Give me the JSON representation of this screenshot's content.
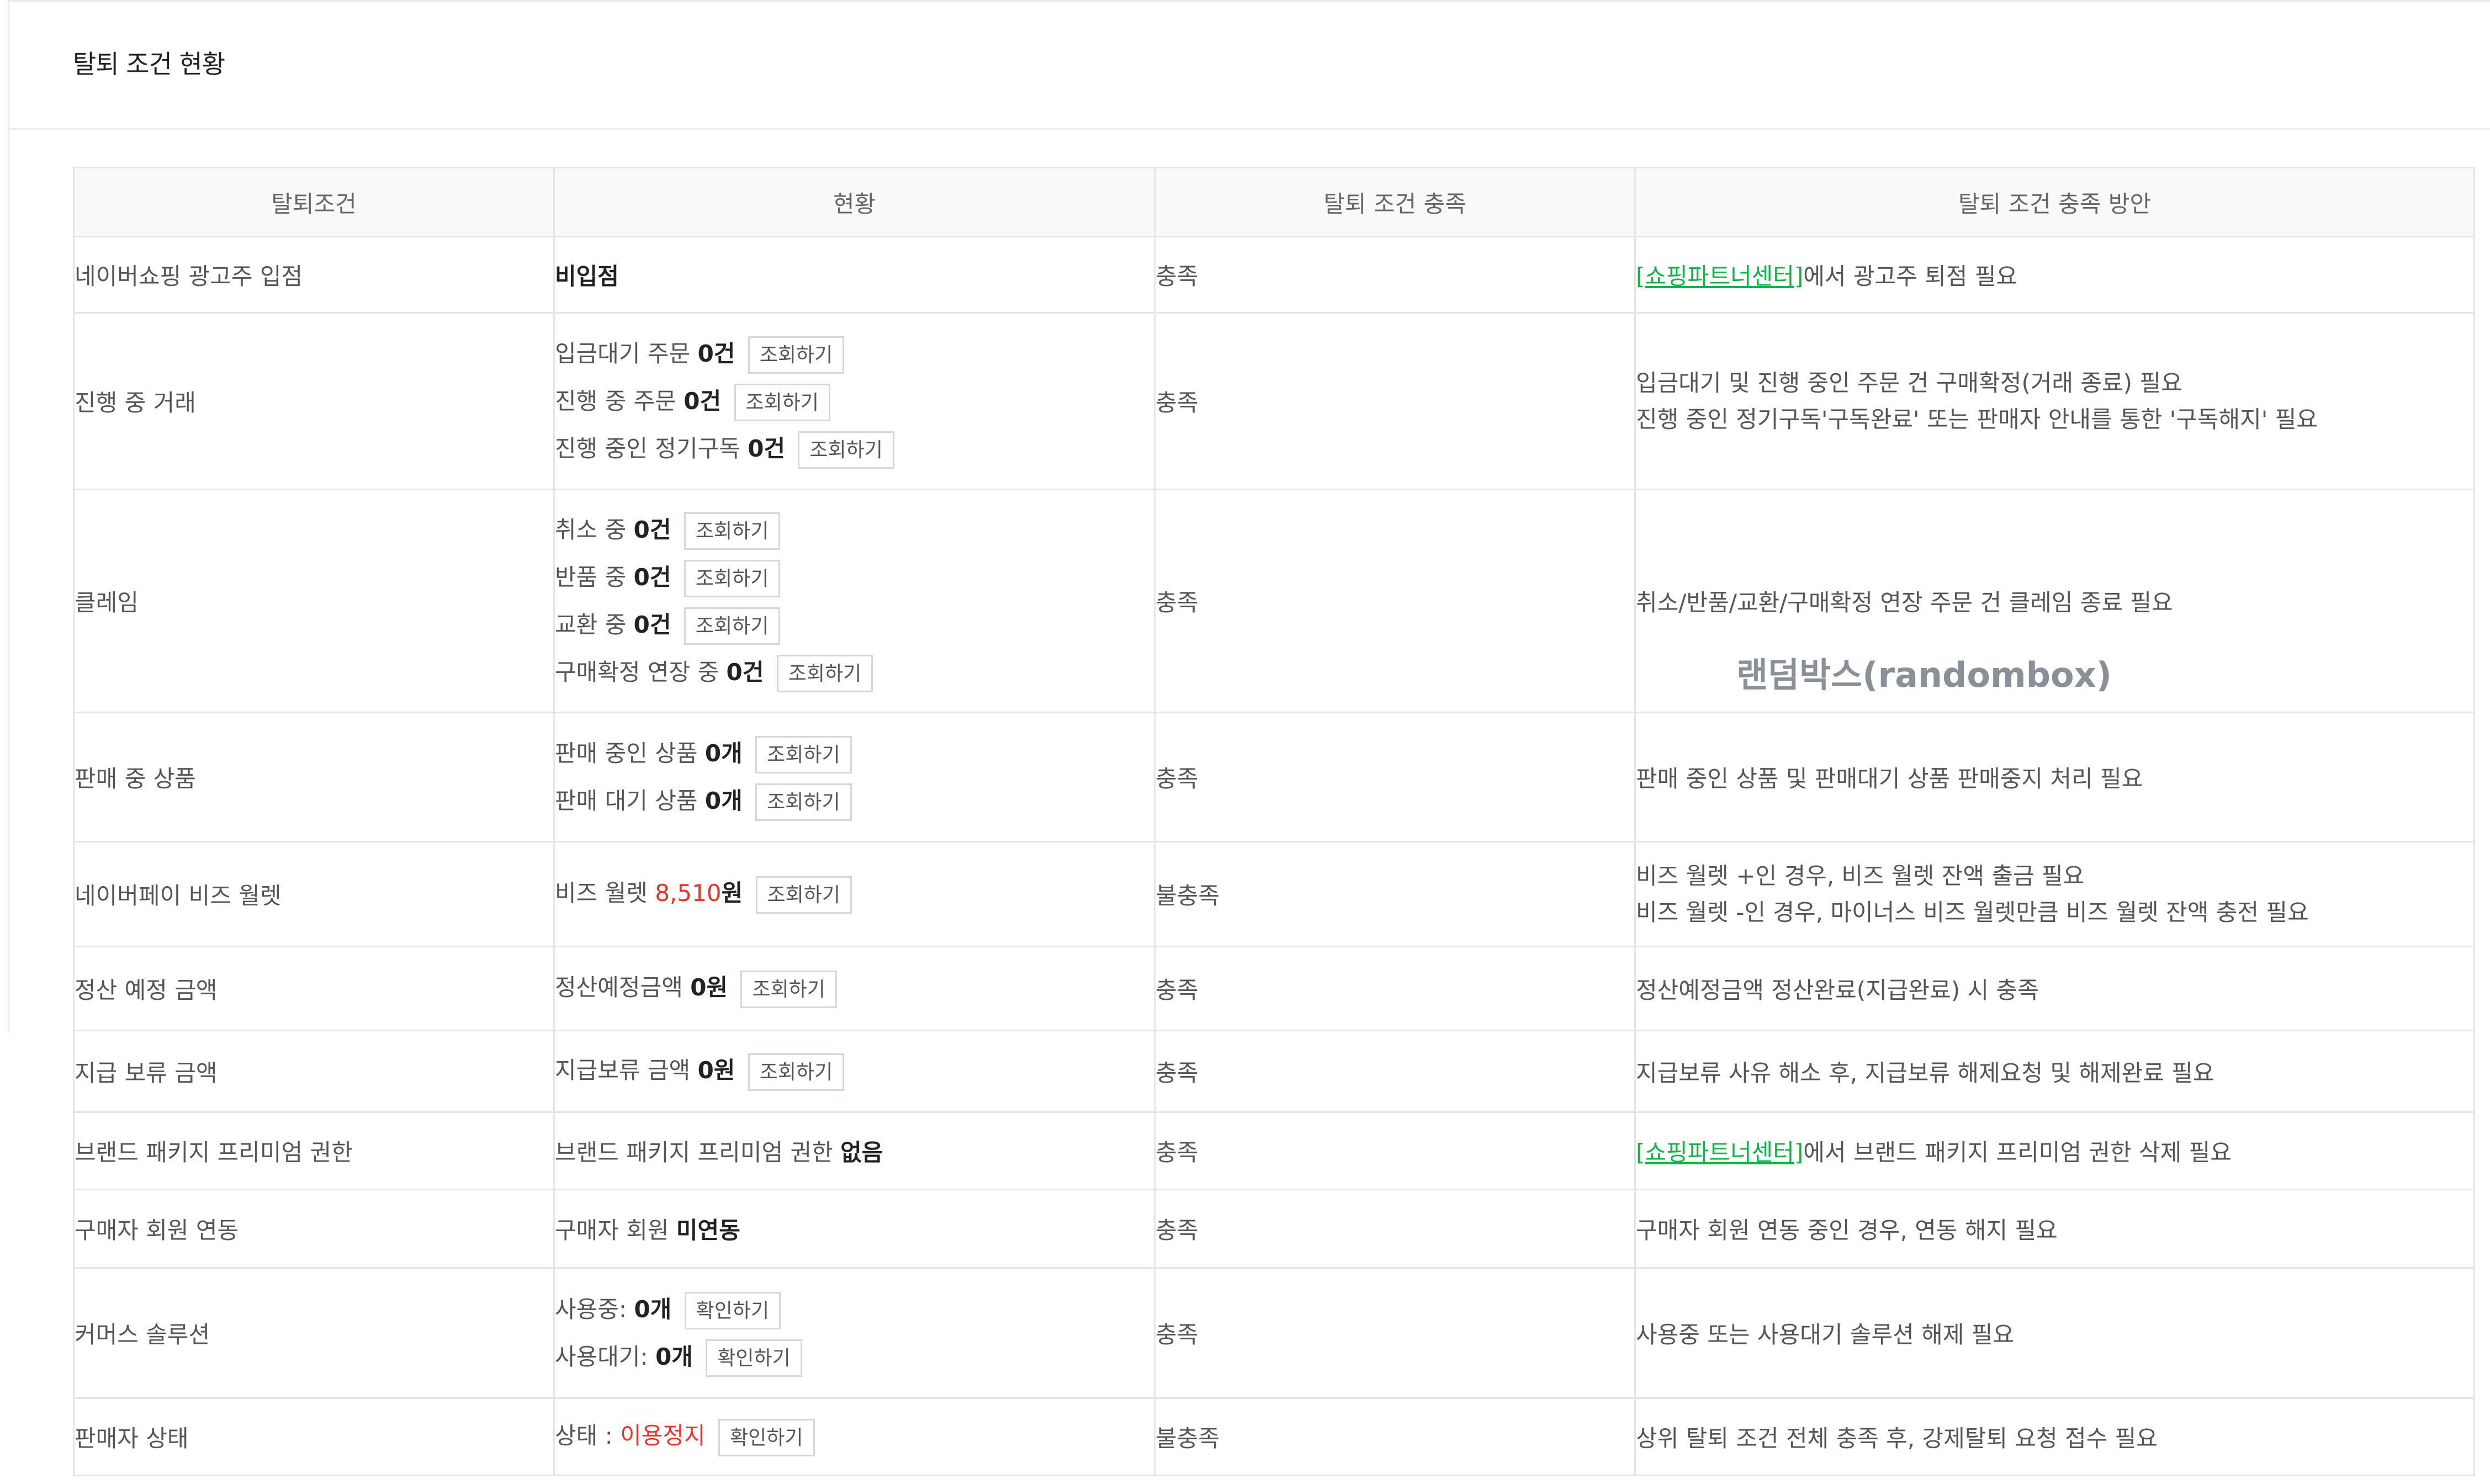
{
  "section_title": "탈퇴 조건 현황",
  "table": {
    "headers": [
      "탈퇴조건",
      "현황",
      "탈퇴 조건 충족",
      "탈퇴 조건 충족 방안"
    ],
    "rows": [
      {
        "name": "네이버쇼핑 광고주 입점",
        "status_text": "비입점",
        "result": "충족",
        "method_link": "[쇼핑파트너센터]",
        "method_rest": "에서 광고주 퇴점 필요"
      },
      {
        "name": "진행 중 거래",
        "items": [
          {
            "label": "입금대기 주문",
            "value": "0건",
            "button": "조회하기"
          },
          {
            "label": "진행 중 주문",
            "value": "0건",
            "button": "조회하기"
          },
          {
            "label": "진행 중인 정기구독",
            "value": "0건",
            "button": "조회하기"
          }
        ],
        "result": "충족",
        "method_lines": [
          "입금대기 및 진행 중인 주문 건 구매확정(거래 종료) 필요",
          "진행 중인 정기구독'구독완료' 또는 판매자 안내를 통한 '구독해지' 필요"
        ]
      },
      {
        "name": "클레임",
        "items": [
          {
            "label": "취소 중",
            "value": "0건",
            "button": "조회하기"
          },
          {
            "label": "반품 중",
            "value": "0건",
            "button": "조회하기"
          },
          {
            "label": "교환 중",
            "value": "0건",
            "button": "조회하기"
          },
          {
            "label": "구매확정 연장 중",
            "value": "0건",
            "button": "조회하기"
          }
        ],
        "result": "충족",
        "method": "취소/반품/교환/구매확정 연장 주문 건 클레임 종료 필요"
      },
      {
        "name": "판매 중 상품",
        "items": [
          {
            "label": "판매 중인 상품",
            "value": "0개",
            "button": "조회하기"
          },
          {
            "label": "판매 대기 상품",
            "value": "0개",
            "button": "조회하기"
          }
        ],
        "result": "충족",
        "method": "판매 중인 상품 및 판매대기 상품 판매중지 처리 필요"
      },
      {
        "name": "네이버페이 비즈 월렛",
        "label": "비즈 월렛",
        "amount": "8,510",
        "unit": "원",
        "button": "조회하기",
        "result": "불충족",
        "method_lines": [
          "비즈 월렛 +인 경우, 비즈 월렛 잔액 출금 필요",
          "비즈 월렛 -인 경우, 마이너스 비즈 월렛만큼 비즈 월렛 잔액 충전 필요"
        ]
      },
      {
        "name": "정산 예정 금액",
        "label": "정산예정금액",
        "value": "0원",
        "button": "조회하기",
        "result": "충족",
        "method": "정산예정금액 정산완료(지급완료) 시 충족"
      },
      {
        "name": "지급 보류 금액",
        "label": "지급보류 금액",
        "value": "0원",
        "button": "조회하기",
        "result": "충족",
        "method": "지급보류 사유 해소 후, 지급보류 해제요청 및 해제완료 필요"
      },
      {
        "name": "브랜드 패키지 프리미엄 권한",
        "label": "브랜드 패키지 프리미엄 권한",
        "value": "없음",
        "result": "충족",
        "method_link": "[쇼핑파트너센터]",
        "method_rest": "에서 브랜드 패키지 프리미엄 권한 삭제 필요"
      },
      {
        "name": "구매자 회원 연동",
        "label": "구매자 회원",
        "value": "미연동",
        "result": "충족",
        "method": "구매자 회원 연동 중인 경우, 연동 해지 필요"
      },
      {
        "name": "커머스 솔루션",
        "items": [
          {
            "label": "사용중:",
            "value": "0개",
            "button": "확인하기"
          },
          {
            "label": "사용대기:",
            "value": "0개",
            "button": "확인하기"
          }
        ],
        "result": "충족",
        "method": "사용중 또는 사용대기 솔루션 해제 필요"
      },
      {
        "name": "판매자 상태",
        "label": "상태 :",
        "value": "이용정지",
        "button": "확인하기",
        "result": "불충족",
        "method": "상위 탈퇴 조건 전체 충족 후, 강제탈퇴 요청 접수 필요"
      }
    ]
  },
  "watermark": "랜덤박스(randombox)",
  "colors": {
    "fail": "#e8352c",
    "link": "#16b04b",
    "border": "#e3e5e8",
    "header_bg": "#f8f9fa"
  }
}
